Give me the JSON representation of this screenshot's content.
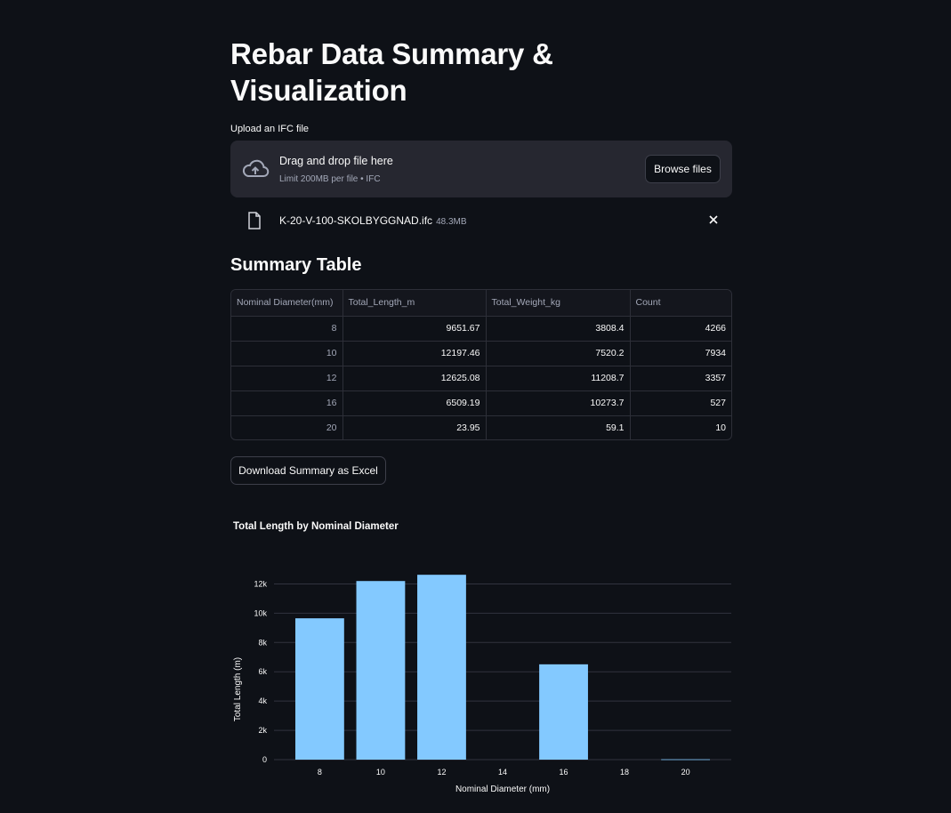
{
  "page": {
    "title": "Rebar Data Summary & Visualization"
  },
  "uploader": {
    "label": "Upload an IFC file",
    "drop_text": "Drag and drop file here",
    "limit_text": "Limit 200MB per file • IFC",
    "browse_label": "Browse files",
    "file_name": "K-20-V-100-SKOLBYGGNAD.ifc",
    "file_size": "48.3MB"
  },
  "summary": {
    "heading": "Summary Table",
    "columns": [
      "Nominal Diameter(mm)",
      "Total_Length_m",
      "Total_Weight_kg",
      "Count"
    ],
    "rows": [
      [
        "8",
        "9651.67",
        "3808.4",
        "4266"
      ],
      [
        "10",
        "12197.46",
        "7520.2",
        "7934"
      ],
      [
        "12",
        "12625.08",
        "11208.7",
        "3357"
      ],
      [
        "16",
        "6509.19",
        "10273.7",
        "527"
      ],
      [
        "20",
        "23.95",
        "59.1",
        "10"
      ]
    ],
    "download_label": "Download Summary as Excel"
  },
  "chart_data": {
    "type": "bar",
    "title": "Total Length by Nominal Diameter",
    "xlabel": "Nominal Diameter (mm)",
    "ylabel": "Total Length (m)",
    "x": [
      8,
      10,
      12,
      16,
      20
    ],
    "values": [
      9651.67,
      12197.46,
      12625.08,
      6509.19,
      23.95
    ],
    "x_ticks": [
      "8",
      "10",
      "12",
      "14",
      "16",
      "18",
      "20"
    ],
    "y_ticks": [
      "0",
      "2k",
      "4k",
      "6k",
      "8k",
      "10k",
      "12k"
    ],
    "xlim": [
      6.5,
      21.5
    ],
    "ylim": [
      0,
      13000
    ],
    "grid": true,
    "bar_color": "#83c9ff"
  },
  "colors": {
    "background": "#0e1117",
    "panel": "#262730",
    "bar": "#83c9ff"
  }
}
